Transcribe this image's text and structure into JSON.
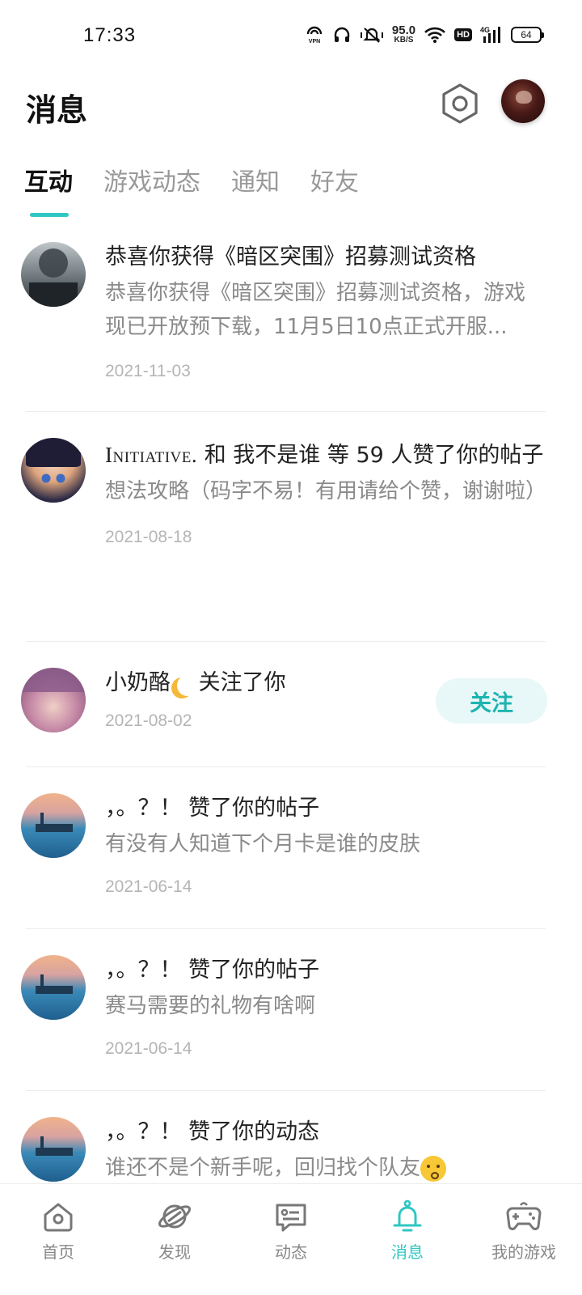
{
  "status_bar": {
    "time": "17:33",
    "speed_value": "95.0",
    "speed_unit": "KB/S",
    "network": "4G",
    "hd": "HD",
    "battery": "64",
    "icons": [
      "vpn-icon",
      "headset-icon",
      "vibrate-icon",
      "wifi-icon",
      "signal-icon"
    ]
  },
  "header": {
    "title": "消息",
    "settings_icon": "hexagon-settings-icon",
    "avatar": "user-avatar"
  },
  "tabs": [
    {
      "label": "互动",
      "active": true
    },
    {
      "label": "游戏动态",
      "active": false
    },
    {
      "label": "通知",
      "active": false
    },
    {
      "label": "好友",
      "active": false
    }
  ],
  "accent_color": "#2fc7c3",
  "messages": [
    {
      "title": "恭喜你获得《暗区突围》招募测试资格",
      "body": "恭喜你获得《暗区突围》招募测试资格，游戏现已开放预下载，11月5日10点正式开服...",
      "date": "2021-11-03"
    },
    {
      "title_user": "Initiative.",
      "title_rest": " 和 我不是谁 等 59 人赞了你的帖子",
      "body": "想法攻略（码字不易！有用请给个赞，谢谢啦）",
      "date": "2021-08-18"
    },
    {
      "title_user": "小奶酪",
      "title_rest": " 关注了你",
      "date": "2021-08-02",
      "follow_label": "关注"
    },
    {
      "title": "，。？！ 赞了你的帖子",
      "body": "有没有人知道下个月卡是谁的皮肤",
      "date": "2021-06-14"
    },
    {
      "title": "，。？！ 赞了你的帖子",
      "body": "赛马需要的礼物有啥啊",
      "date": "2021-06-14"
    },
    {
      "title": "，。？！ 赞了你的动态",
      "body": "谁还不是个新手呢，回归找个队友"
    }
  ],
  "bottom_nav": [
    {
      "label": "首页",
      "icon": "home-icon"
    },
    {
      "label": "发现",
      "icon": "planet-icon"
    },
    {
      "label": "动态",
      "icon": "chat-card-icon"
    },
    {
      "label": "消息",
      "icon": "bell-icon",
      "active": true
    },
    {
      "label": "我的游戏",
      "icon": "gamepad-icon"
    }
  ]
}
